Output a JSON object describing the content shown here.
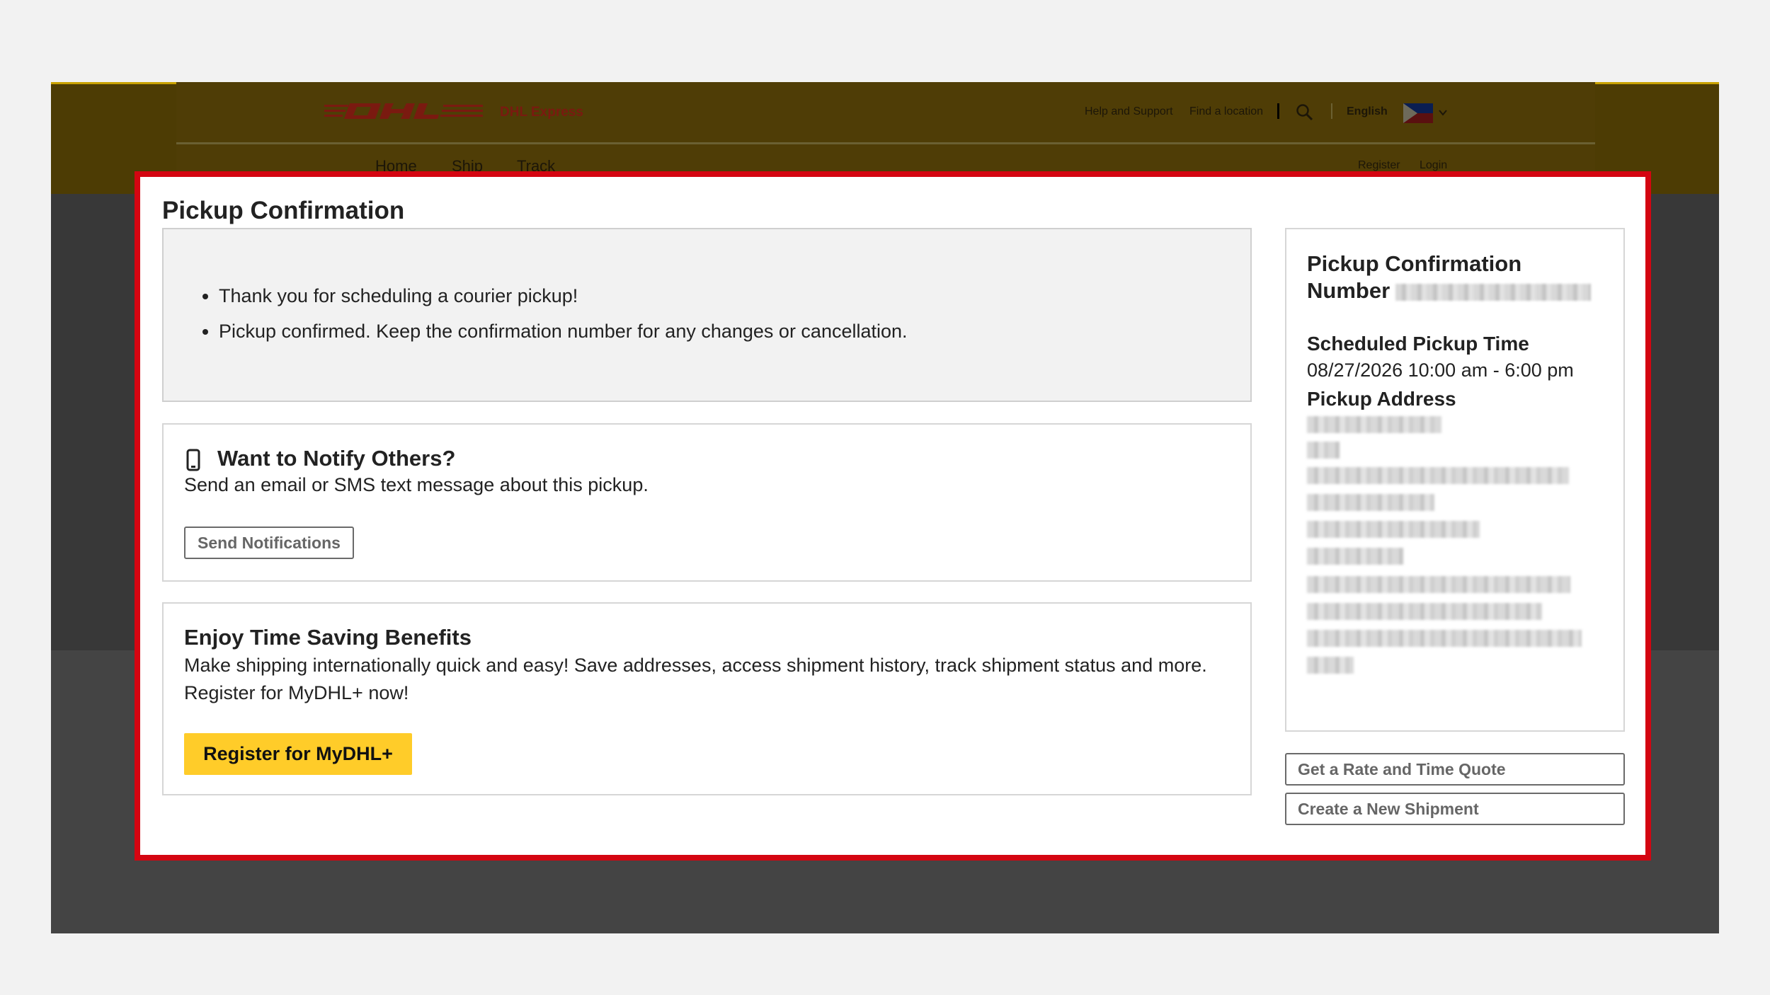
{
  "header": {
    "brand": "DHL Express",
    "utility": {
      "help": "Help and Support",
      "find_location": "Find a location",
      "language": "English"
    },
    "nav": [
      "Home",
      "Ship",
      "Track"
    ],
    "account": {
      "register": "Register",
      "login": "Login"
    }
  },
  "confirmation": {
    "title": "Pickup Confirmation",
    "messages": [
      "Thank you for scheduling a courier pickup!",
      "Pickup confirmed. Keep the confirmation number for any changes or cancellation."
    ]
  },
  "notify": {
    "title": "Want to Notify Others?",
    "text": "Send an email or SMS text message about this pickup.",
    "button": "Send Notifications"
  },
  "benefits": {
    "title": "Enjoy Time Saving Benefits",
    "text": "Make shipping internationally quick and easy! Save addresses, access shipment history, track shipment status and more. Register for MyDHL+ now!",
    "button": "Register for MyDHL+"
  },
  "summary": {
    "number_label": "Pickup Confirmation Number",
    "time_label": "Scheduled Pickup Time",
    "time_value": "08/27/2026 10:00 am - 6:00 pm",
    "address_label": "Pickup Address"
  },
  "actions": {
    "rate_quote": "Get a Rate and Time Quote",
    "new_shipment": "Create a New Shipment"
  },
  "colors": {
    "dhl_yellow": "#ffcc29",
    "dhl_red": "#d40511",
    "overlay_header": "#4d3c04"
  },
  "icons": [
    "search-icon",
    "flag-icon",
    "chevron-down-icon",
    "mobile-phone-icon"
  ]
}
